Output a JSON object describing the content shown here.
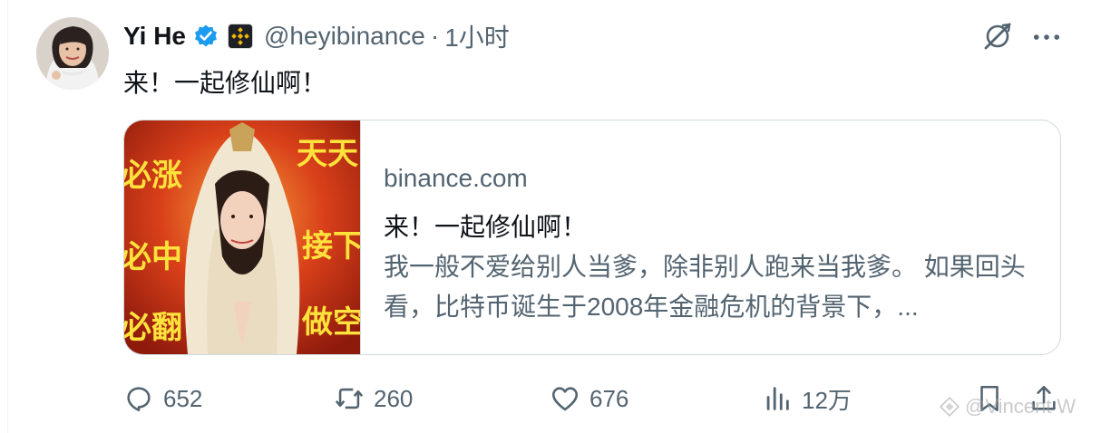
{
  "author": {
    "name": "Yi He",
    "handle": "@heyibinance",
    "separator": "·",
    "time": "1小时"
  },
  "tweet": {
    "text": "来！一起修仙啊！"
  },
  "card": {
    "domain": "binance.com",
    "title": "来！一起修仙啊！",
    "description": "我一般不爱给别人当爹，除非别人跑来当我爹。 如果回头看，比特币诞生于2008年金融危机的背景下，...",
    "image_text": [
      "必涨",
      "天天",
      "必中",
      "接下",
      "必翻",
      "做空"
    ]
  },
  "actions": {
    "replies": "652",
    "reposts": "260",
    "likes": "676",
    "views": "12万"
  },
  "watermark": {
    "text": "@Vincent W"
  },
  "colors": {
    "text": "#0f1419",
    "muted": "#536471",
    "verified": "#1d9bf0",
    "border": "#cfd9de",
    "binance": "#f0b90b"
  },
  "icons": {
    "verified": "verified-badge-icon",
    "affiliate": "binance-affiliate-icon",
    "grok": "grok-icon",
    "more": "more-icon",
    "reply": "reply-icon",
    "repost": "repost-icon",
    "like": "like-icon",
    "views": "views-icon",
    "bookmark": "bookmark-icon",
    "share": "share-icon"
  }
}
